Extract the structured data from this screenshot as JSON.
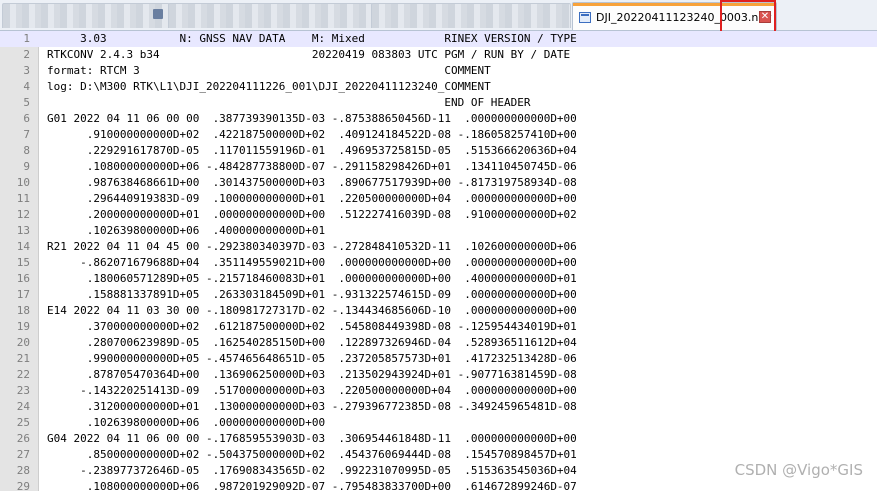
{
  "tabs": {
    "active": {
      "title": "DJI_20220411123240_0003.nav",
      "close_glyph": "✕"
    }
  },
  "editor": {
    "lines": [
      {
        "n": "1",
        "text": "     3.03           N: GNSS NAV DATA    M: Mixed            RINEX VERSION / TYPE"
      },
      {
        "n": "2",
        "text": "RTKCONV 2.4.3 b34                       20220419 083803 UTC PGM / RUN BY / DATE"
      },
      {
        "n": "3",
        "text": "format: RTCM 3                                              COMMENT"
      },
      {
        "n": "4",
        "text": "log: D:\\M300 RTK\\L1\\DJI_202204111226_001\\DJI_20220411123240_COMMENT"
      },
      {
        "n": "5",
        "text": "                                                            END OF HEADER"
      },
      {
        "n": "6",
        "text": "G01 2022 04 11 06 00 00  .387739390135D-03 -.875388650456D-11  .000000000000D+00"
      },
      {
        "n": "7",
        "text": "      .910000000000D+02  .422187500000D+02  .409124184522D-08 -.186058257410D+00"
      },
      {
        "n": "8",
        "text": "      .229291617870D-05  .117011559196D-01  .496953725815D-05  .515366620636D+04"
      },
      {
        "n": "9",
        "text": "      .108000000000D+06 -.484287738800D-07 -.291158298426D+01  .134110450745D-06"
      },
      {
        "n": "10",
        "text": "      .987638468661D+00  .301437500000D+03  .890677517939D+00 -.817319758934D-08"
      },
      {
        "n": "11",
        "text": "      .296440919383D-09  .100000000000D+01  .220500000000D+04  .000000000000D+00"
      },
      {
        "n": "12",
        "text": "      .200000000000D+01  .000000000000D+00  .512227416039D-08  .910000000000D+02"
      },
      {
        "n": "13",
        "text": "      .102639800000D+06  .400000000000D+01"
      },
      {
        "n": "14",
        "text": "R21 2022 04 11 04 45 00 -.292380340397D-03 -.272848410532D-11  .102600000000D+06"
      },
      {
        "n": "15",
        "text": "     -.862071679688D+04  .351149559021D+00  .000000000000D+00  .000000000000D+00"
      },
      {
        "n": "16",
        "text": "      .180060571289D+05 -.215718460083D+01  .000000000000D+00  .400000000000D+01"
      },
      {
        "n": "17",
        "text": "      .158881337891D+05  .263303184509D+01 -.931322574615D-09  .000000000000D+00"
      },
      {
        "n": "18",
        "text": "E14 2022 04 11 03 30 00 -.180981727317D-02 -.134434685606D-10  .000000000000D+00"
      },
      {
        "n": "19",
        "text": "      .370000000000D+02  .612187500000D+02  .545808449398D-08 -.125954434019D+01"
      },
      {
        "n": "20",
        "text": "      .280700623989D-05  .162540285150D+00  .122897326946D-04  .528936511612D+04"
      },
      {
        "n": "21",
        "text": "      .990000000000D+05 -.457465648651D-05  .237205857573D+01  .417232513428D-06"
      },
      {
        "n": "22",
        "text": "      .878705470364D+00  .136906250000D+03  .213502943924D+01 -.907716381459D-08"
      },
      {
        "n": "23",
        "text": "     -.143220251413D-09  .517000000000D+03  .220500000000D+04  .000000000000D+00"
      },
      {
        "n": "24",
        "text": "      .312000000000D+01  .130000000000D+03 -.279396772385D-08 -.349245965481D-08"
      },
      {
        "n": "25",
        "text": "      .102639800000D+06  .000000000000D+00"
      },
      {
        "n": "26",
        "text": "G04 2022 04 11 06 00 00 -.176859553903D-03  .306954461848D-11  .000000000000D+00"
      },
      {
        "n": "27",
        "text": "      .850000000000D+02 -.504375000000D+02  .454376069444D-08  .154570898457D+01"
      },
      {
        "n": "28",
        "text": "     -.238977372646D-05  .176908343565D-02  .992231070995D-05  .515363545036D+04"
      },
      {
        "n": "29",
        "text": "      .108000000000D+06  .987201929092D-07 -.795483833700D+00  .614672899246D-07"
      }
    ]
  },
  "watermark": "CSDN @Vigo*GIS"
}
